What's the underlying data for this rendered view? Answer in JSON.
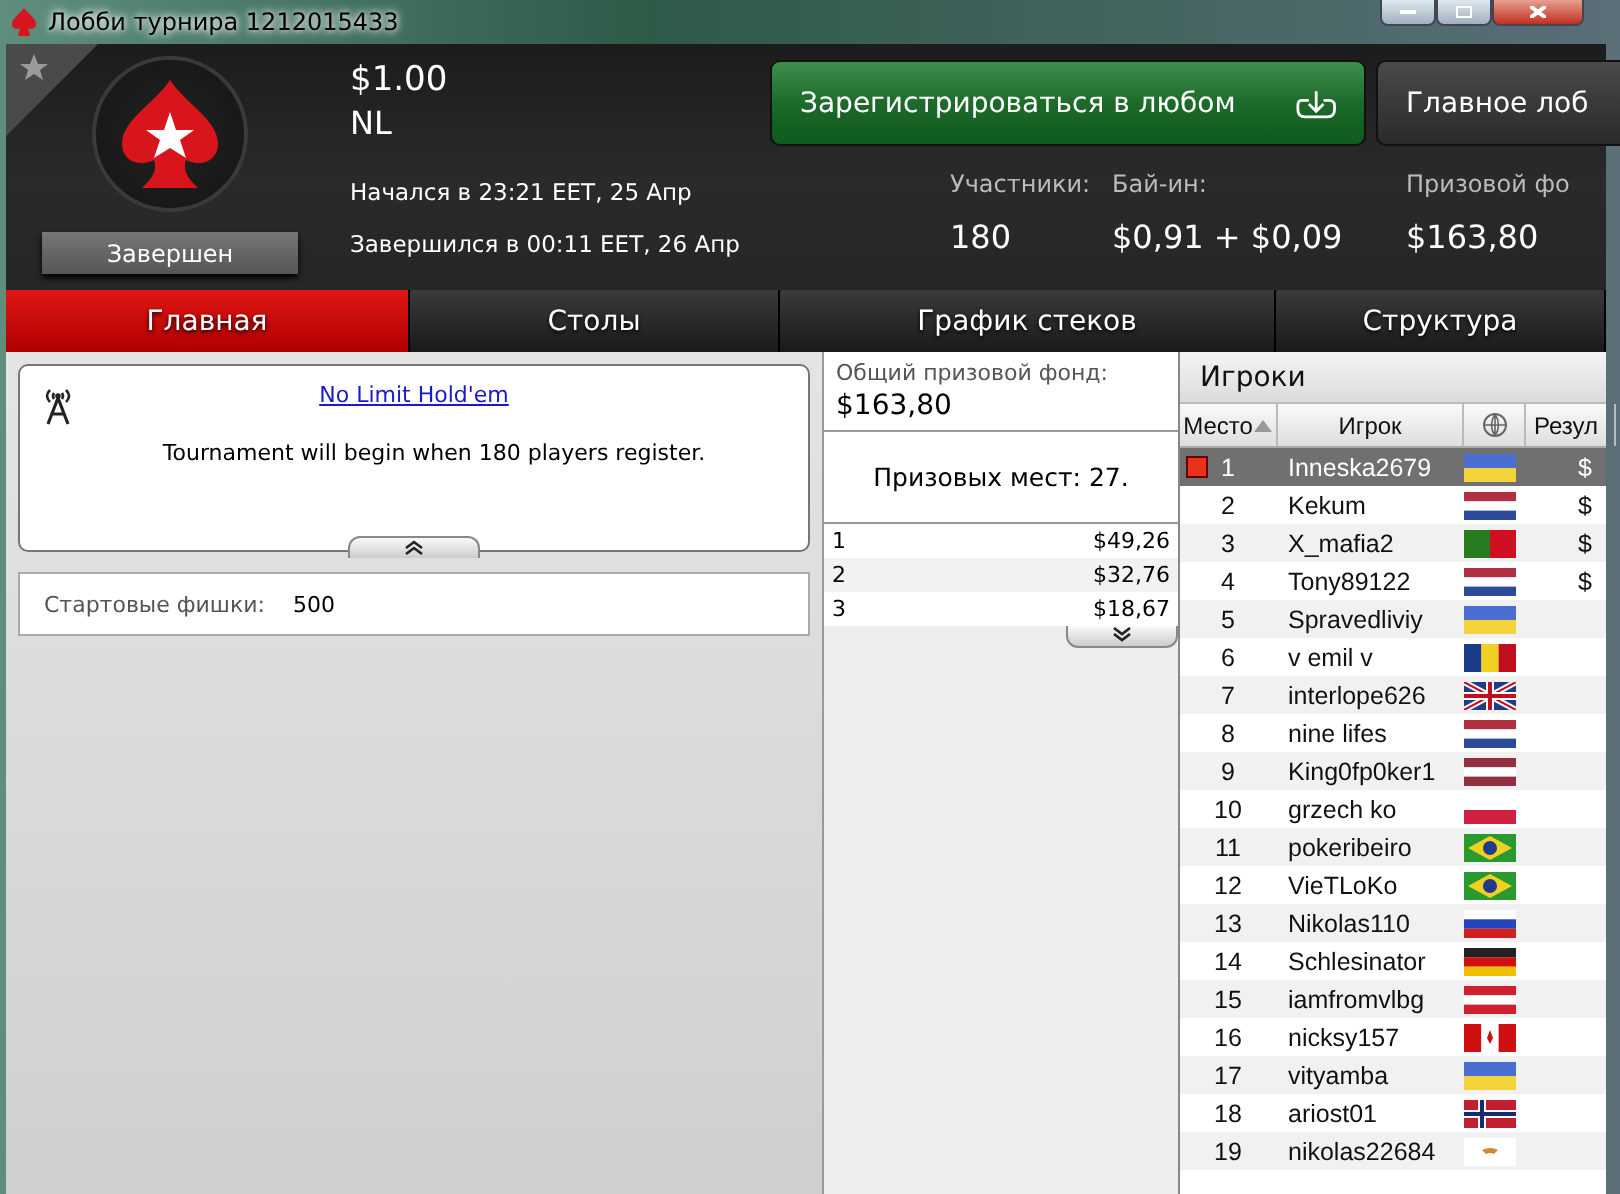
{
  "window": {
    "title": "Лобби турнира 1212015433"
  },
  "header": {
    "buy_in": "$1.00",
    "game": "NL",
    "status": "Завершен",
    "started": "Начался в 23:21 EET, 25 Апр",
    "finished": "Завершился в 00:11 EET, 26 Апр",
    "favorite": false,
    "buttons": [
      {
        "label": "Зарегистрироваться в любом",
        "kind": "primary"
      },
      {
        "label": "Главное лоб",
        "kind": "secondary"
      }
    ],
    "stats": [
      {
        "label": "Участники:",
        "value": "180"
      },
      {
        "label": "Бай-ин:",
        "value": "$0,91 + $0,09"
      },
      {
        "label": "Призовой фо",
        "value": "$163,80"
      }
    ]
  },
  "tabs": [
    {
      "label": "Главная",
      "selected": true
    },
    {
      "label": "Столы",
      "selected": false
    },
    {
      "label": "График стеков",
      "selected": false
    },
    {
      "label": "Структура",
      "selected": false
    }
  ],
  "info": {
    "game_link": "No Limit Hold'em",
    "message": "Tournament will begin when 180 players register.",
    "chips_label": "Стартовые фишки:",
    "chips_value": "500"
  },
  "prizes": {
    "pool_label": "Общий призовой фонд:",
    "pool_value": "$163,80",
    "places": "Призовых мест: 27.",
    "rows": [
      {
        "place": "1",
        "amount": "$49,26"
      },
      {
        "place": "2",
        "amount": "$32,76"
      },
      {
        "place": "3",
        "amount": "$18,67"
      }
    ]
  },
  "players": {
    "title": "Игроки",
    "columns": [
      "Место",
      "Игрок",
      "Резул"
    ],
    "rows": [
      {
        "place": "1",
        "name": "Inneska2679",
        "kind": "ua",
        "result": "$",
        "selected": true
      },
      {
        "place": "2",
        "name": "Kekum",
        "kind": "nl",
        "result": "$",
        "selected": false
      },
      {
        "place": "3",
        "name": "X_mafia2",
        "kind": "pt",
        "result": "$",
        "selected": false
      },
      {
        "place": "4",
        "name": "Tony89122",
        "kind": "nl",
        "result": "$",
        "selected": false
      },
      {
        "place": "5",
        "name": "Spravedliviy",
        "kind": "ua",
        "selected": false
      },
      {
        "place": "6",
        "name": "v emil v",
        "kind": "ro",
        "selected": false
      },
      {
        "place": "7",
        "name": "interlope626",
        "kind": "gb",
        "selected": false
      },
      {
        "place": "8",
        "name": "nine lifes",
        "kind": "nl",
        "selected": false
      },
      {
        "place": "9",
        "name": "King0fp0ker1",
        "kind": "lv",
        "selected": false
      },
      {
        "place": "10",
        "name": "grzech ko",
        "kind": "pl",
        "selected": false
      },
      {
        "place": "11",
        "name": "pokeribeiro",
        "kind": "br",
        "selected": false
      },
      {
        "place": "12",
        "name": "VieTLoKo",
        "kind": "br",
        "selected": false
      },
      {
        "place": "13",
        "name": "Nikolas110",
        "kind": "ru",
        "selected": false
      },
      {
        "place": "14",
        "name": "Schlesinator",
        "kind": "de",
        "selected": false
      },
      {
        "place": "15",
        "name": "iamfromvlbg",
        "kind": "at",
        "selected": false
      },
      {
        "place": "16",
        "name": "nicksy157",
        "kind": "ca",
        "selected": false
      },
      {
        "place": "17",
        "name": "vityamba",
        "kind": "ua",
        "selected": false
      },
      {
        "place": "18",
        "name": "ariost01",
        "kind": "no",
        "selected": false
      },
      {
        "place": "19",
        "name": "nikolas22684",
        "kind": "cy",
        "selected": false
      }
    ]
  }
}
